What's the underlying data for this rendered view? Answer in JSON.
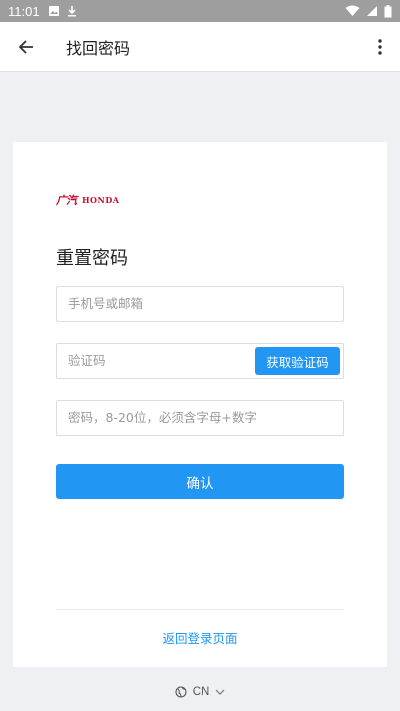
{
  "status_bar": {
    "time": "11:01",
    "icons": [
      "image-icon",
      "download-icon",
      "wifi-icon",
      "signal-icon",
      "battery-icon"
    ]
  },
  "app_bar": {
    "title": "找回密码",
    "back_icon": "arrow-back-icon",
    "menu_icon": "more-vert-icon"
  },
  "card": {
    "logo_cn": "广汽",
    "logo_en": "HONDA",
    "heading": "重置密码",
    "phone_placeholder": "手机号或邮箱",
    "code_placeholder": "验证码",
    "get_code_label": "获取验证码",
    "password_placeholder": "密码，8-20位，必须含字母+数字",
    "confirm_label": "确认",
    "back_to_login": "返回登录页面"
  },
  "language": {
    "code": "CN",
    "icon": "globe-icon"
  },
  "colors": {
    "accent": "#2196f3",
    "brand_red": "#c8102e",
    "background": "#eef0f3"
  }
}
